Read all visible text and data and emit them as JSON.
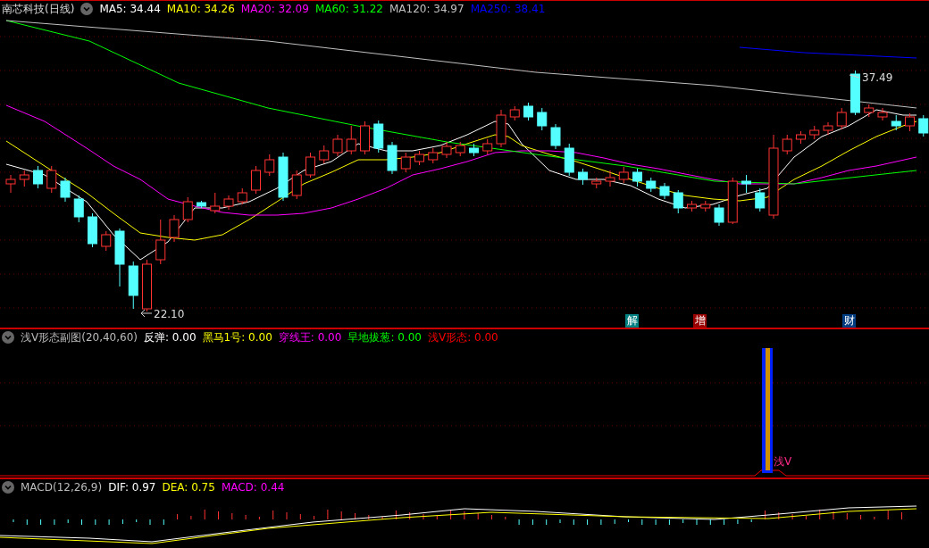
{
  "main_panel": {
    "title": "南芯科技(日线)",
    "indicators": [
      {
        "label": "MA5: 34.44",
        "color": "#ffffff"
      },
      {
        "label": "MA10: 34.26",
        "color": "#ffff00"
      },
      {
        "label": "MA20: 32.09",
        "color": "#ff00ff"
      },
      {
        "label": "MA60: 31.22",
        "color": "#00ff00"
      },
      {
        "label": "MA120: 34.97",
        "color": "#c0c0c0"
      },
      {
        "label": "MA250: 38.41",
        "color": "#0000ff"
      }
    ],
    "high_label": "37.49",
    "low_label": "22.10",
    "event_markers": [
      {
        "text": "解",
        "color": "#008080"
      },
      {
        "text": "增",
        "color": "#990000"
      },
      {
        "text": "财",
        "color": "#003d80"
      }
    ]
  },
  "sub_panel": {
    "title": "浅V形态副图(20,40,60)",
    "indicators": [
      {
        "label": "反弹: 0.00",
        "color": "#ffffff"
      },
      {
        "label": "黑马1号: 0.00",
        "color": "#ffff00"
      },
      {
        "label": "穿线王: 0.00",
        "color": "#ff00ff"
      },
      {
        "label": "旱地拔葱: 0.00",
        "color": "#00ff00"
      },
      {
        "label": "浅V形态: 0.00",
        "color": "#ff0000"
      }
    ],
    "signal_label": "浅V"
  },
  "macd_panel": {
    "title": "MACD(12,26,9)",
    "indicators": [
      {
        "label": "DIF: 0.97",
        "color": "#ffffff"
      },
      {
        "label": "DEA: 0.75",
        "color": "#ffff00"
      },
      {
        "label": "MACD: 0.44",
        "color": "#ff00ff"
      }
    ]
  }
}
